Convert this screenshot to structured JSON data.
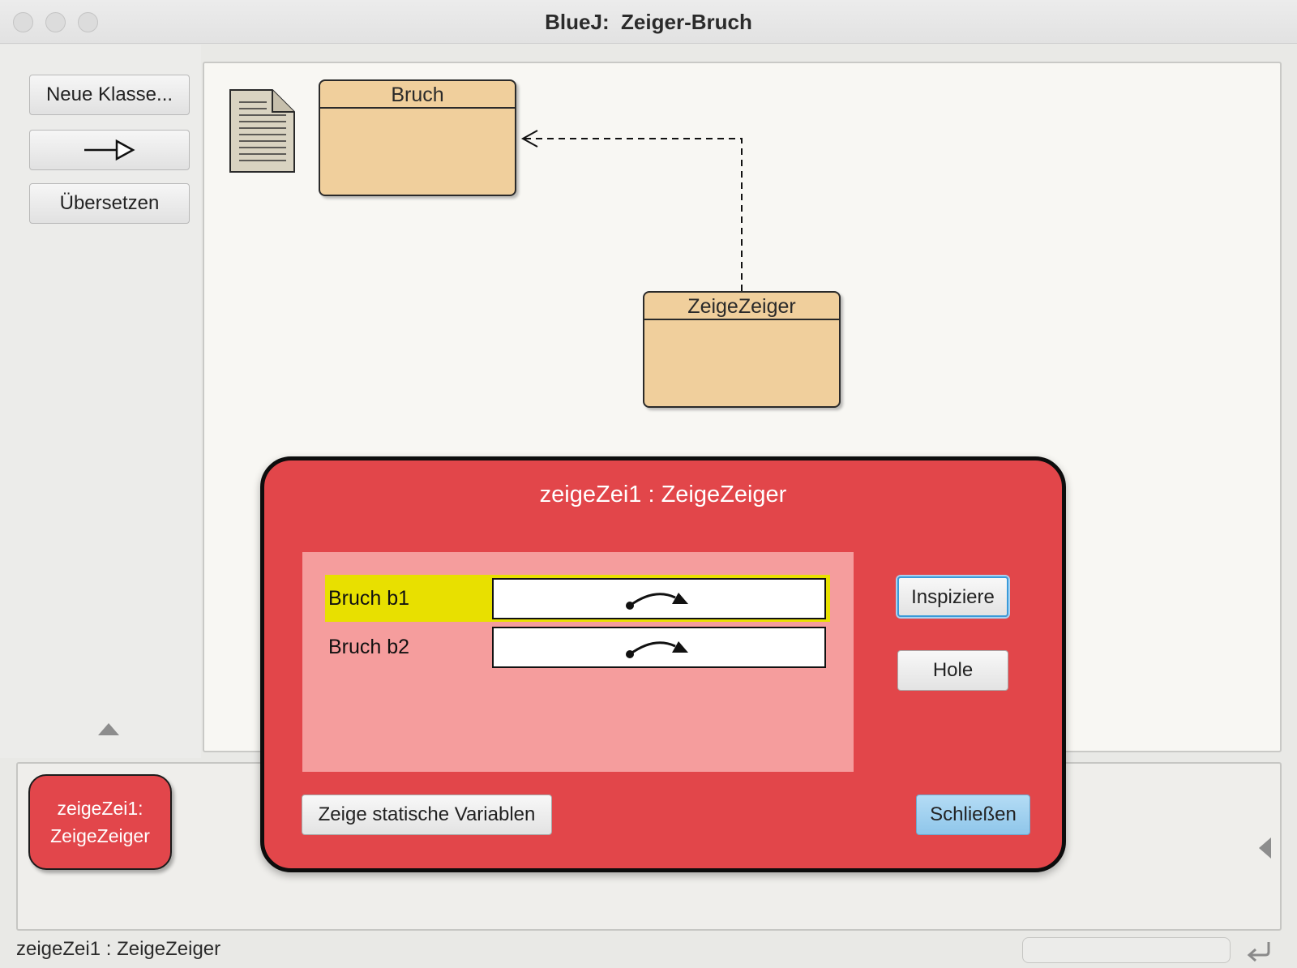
{
  "window": {
    "title": "BlueJ:  Zeiger-Bruch"
  },
  "toolbar": {
    "new_class_label": "Neue Klasse...",
    "arrow_icon": "inheritance-arrow-icon",
    "compile_label": "Übersetzen"
  },
  "diagram": {
    "classes": [
      {
        "name": "Bruch"
      },
      {
        "name": "ZeigeZeiger"
      }
    ]
  },
  "inspector": {
    "title": "zeigeZei1 : ZeigeZeiger",
    "fields": [
      {
        "name": "Bruch b1",
        "value_icon": "object-reference-arrow-icon"
      },
      {
        "name": "Bruch b2",
        "value_icon": "object-reference-arrow-icon"
      }
    ],
    "inspect_label": "Inspiziere",
    "get_label": "Hole",
    "static_label": "Zeige statische Variablen",
    "close_label": "Schließen"
  },
  "bench": {
    "object_name": "zeigeZei1:",
    "object_type": "ZeigeZeiger"
  },
  "status": {
    "text": "zeigeZei1 : ZeigeZeiger"
  },
  "colors": {
    "class_fill": "#f0cf9c",
    "object_red": "#e2464a",
    "field_panel": "#f59d9d",
    "selected_field": "#e8e000"
  }
}
